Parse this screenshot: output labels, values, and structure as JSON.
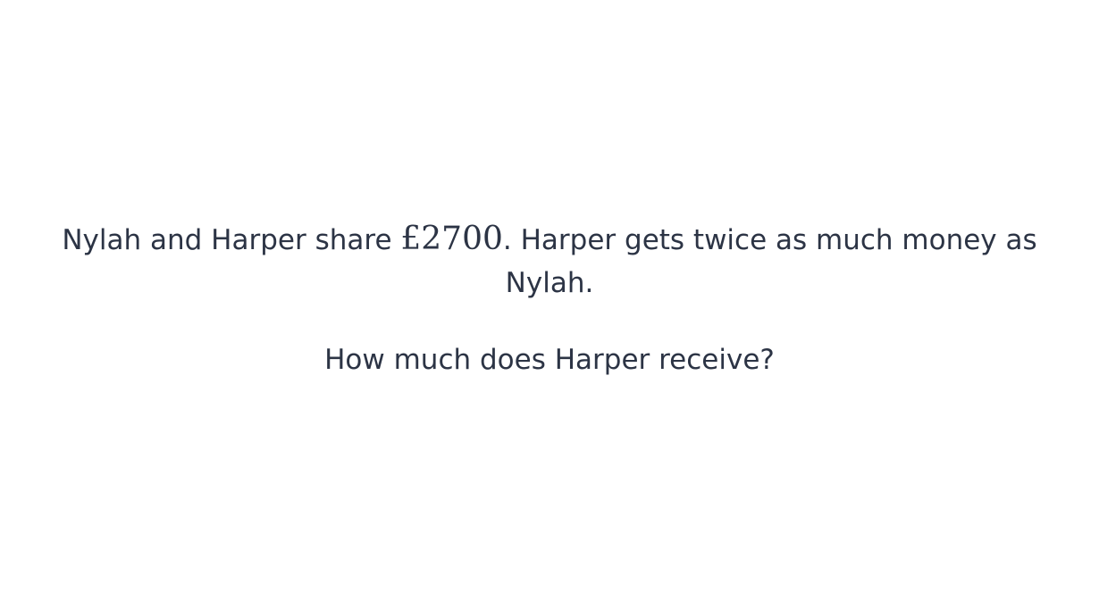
{
  "question": {
    "statement_before": "Nylah and Harper share ",
    "amount": "£2700",
    "statement_after": ". Harper gets twice as much money as Nylah.",
    "ask": "How much does Harper receive?"
  }
}
